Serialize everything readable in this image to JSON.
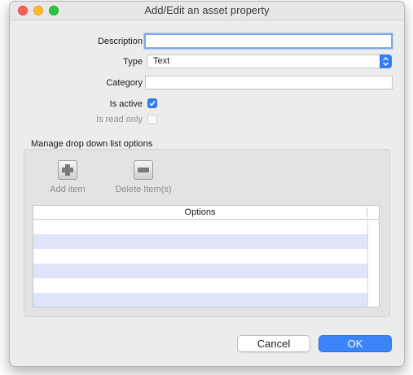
{
  "window": {
    "title": "Add/Edit an asset property"
  },
  "form": {
    "description_label": "Description",
    "description_value": "",
    "type_label": "Type",
    "type_value": "Text",
    "category_label": "Category",
    "category_value": "",
    "is_active_label": "Is active",
    "is_active_checked": true,
    "is_read_only_label": "Is read only",
    "is_read_only_checked": false
  },
  "dropdown_options": {
    "section_title": "Manage drop down list options",
    "add_item_label": "Add item",
    "delete_items_label": "Delete Item(s)",
    "table_header": "Options",
    "rows": [
      "",
      "",
      "",
      "",
      "",
      ""
    ]
  },
  "buttons": {
    "cancel_label": "Cancel",
    "ok_label": "OK"
  },
  "colors": {
    "accent": "#2f7cf6",
    "row_alt": "#dfe4fb",
    "close": "#fc5f57",
    "minimize": "#febc2e",
    "maximize": "#28c840"
  }
}
